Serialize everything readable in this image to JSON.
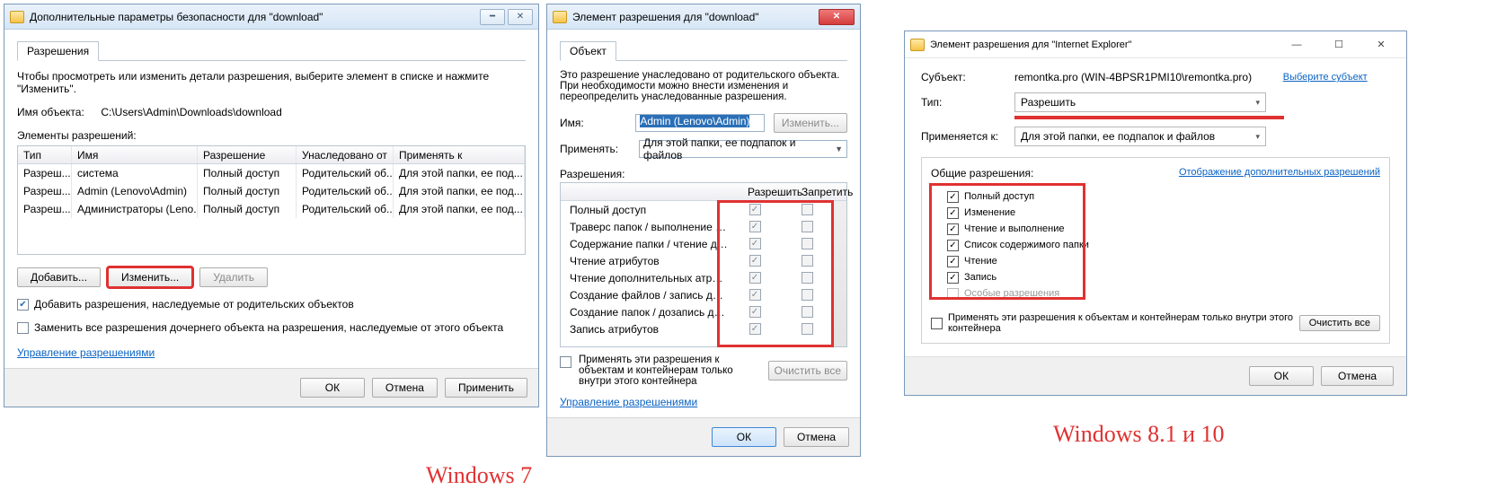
{
  "captions": {
    "win7": "Windows 7",
    "win10": "Windows 8.1 и 10"
  },
  "dlg1": {
    "title": "Дополнительные параметры безопасности  для \"download\"",
    "tab": "Разрешения",
    "desc": "Чтобы просмотреть или изменить детали разрешения, выберите элемент в списке и нажмите \"Изменить\".",
    "obj_label": "Имя объекта:",
    "obj_value": "C:\\Users\\Admin\\Downloads\\download",
    "list_label": "Элементы разрешений:",
    "cols": {
      "c1": "Тип",
      "c2": "Имя",
      "c3": "Разрешение",
      "c4": "Унаследовано от",
      "c5": "Применять к"
    },
    "rows": [
      {
        "c1": "Разреш...",
        "c2": "система",
        "c3": "Полный доступ",
        "c4": "Родительский об...",
        "c5": "Для этой папки, ее под..."
      },
      {
        "c1": "Разреш...",
        "c2": "Admin (Lenovo\\Admin)",
        "c3": "Полный доступ",
        "c4": "Родительский об...",
        "c5": "Для этой папки, ее под..."
      },
      {
        "c1": "Разреш...",
        "c2": "Администраторы (Leno...",
        "c3": "Полный доступ",
        "c4": "Родительский об...",
        "c5": "Для этой папки, ее под..."
      }
    ],
    "btn_add": "Добавить...",
    "btn_edit": "Изменить...",
    "btn_del": "Удалить",
    "chk1": "Добавить разрешения, наследуемые от родительских объектов",
    "chk2": "Заменить все разрешения дочернего объекта на разрешения, наследуемые от этого объекта",
    "link": "Управление разрешениями",
    "ok": "ОК",
    "cancel": "Отмена",
    "apply": "Применить"
  },
  "dlg2": {
    "title": "Элемент разрешения для \"download\"",
    "tab": "Объект",
    "desc": "Это разрешение унаследовано от родительского объекта. При необходимости можно внести изменения и переопределить унаследованные разрешения.",
    "name_label": "Имя:",
    "name_value": "Admin (Lenovo\\Admin)",
    "btn_change": "Изменить...",
    "apply_label": "Применять:",
    "apply_value": "Для этой папки, ее подпапок и файлов",
    "perm_label": "Разрешения:",
    "perm_allow": "Разрешить",
    "perm_deny": "Запретить",
    "perms": [
      "Полный доступ",
      "Траверс папок / выполнение файлов",
      "Содержание папки / чтение данных",
      "Чтение атрибутов",
      "Чтение дополнительных атрибутов",
      "Создание файлов / запись данных",
      "Создание папок / дозапись данных",
      "Запись атрибутов"
    ],
    "apply_only": "Применять эти разрешения к объектам и контейнерам только внутри этого контейнера",
    "clear": "Очистить все",
    "link": "Управление разрешениями",
    "ok": "ОК",
    "cancel": "Отмена"
  },
  "dlg3": {
    "title": "Элемент разрешения для \"Internet Explorer\"",
    "subject_label": "Субъект:",
    "subject_value": "remontka.pro (WIN-4BPSR1PMI10\\remontka.pro)",
    "subject_link": "Выберите субъект",
    "type_label": "Тип:",
    "type_value": "Разрешить",
    "apply_label": "Применяется к:",
    "apply_value": "Для этой папки, ее подпапок и файлов",
    "group_title": "Общие разрешения:",
    "group_link": "Отображение дополнительных разрешений",
    "perms": [
      "Полный доступ",
      "Изменение",
      "Чтение и выполнение",
      "Список содержимого папки",
      "Чтение",
      "Запись",
      "Особые разрешения"
    ],
    "apply_only": "Применять эти разрешения к объектам и контейнерам только внутри этого контейнера",
    "clear": "Очистить все",
    "ok": "ОК",
    "cancel": "Отмена"
  }
}
